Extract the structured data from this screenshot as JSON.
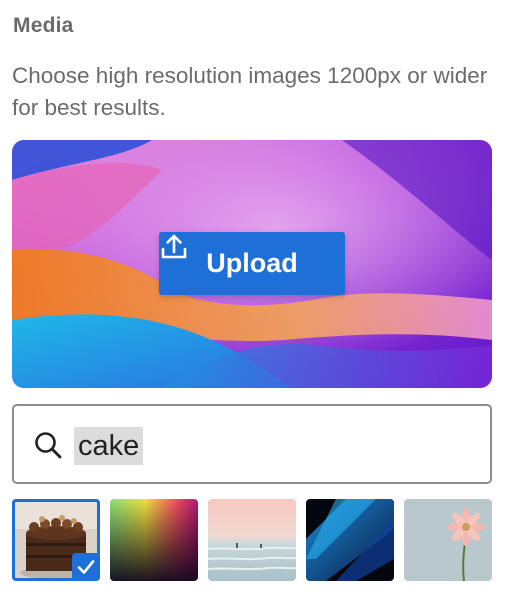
{
  "section": {
    "title": "Media",
    "help": "Choose high resolution images 1200px or wider for best results."
  },
  "upload": {
    "label": "Upload",
    "icon": "upload-icon"
  },
  "search": {
    "value": "cake",
    "icon": "search-icon"
  },
  "thumbnails": [
    {
      "subject": "chocolate cake",
      "selected": true
    },
    {
      "subject": "color gradient",
      "selected": false
    },
    {
      "subject": "beach",
      "selected": false
    },
    {
      "subject": "blue abstract",
      "selected": false
    },
    {
      "subject": "pink flower",
      "selected": false
    }
  ],
  "colors": {
    "accent": "#1f6fd8",
    "label": "#6b6b6b",
    "border": "#8c8c8c"
  }
}
